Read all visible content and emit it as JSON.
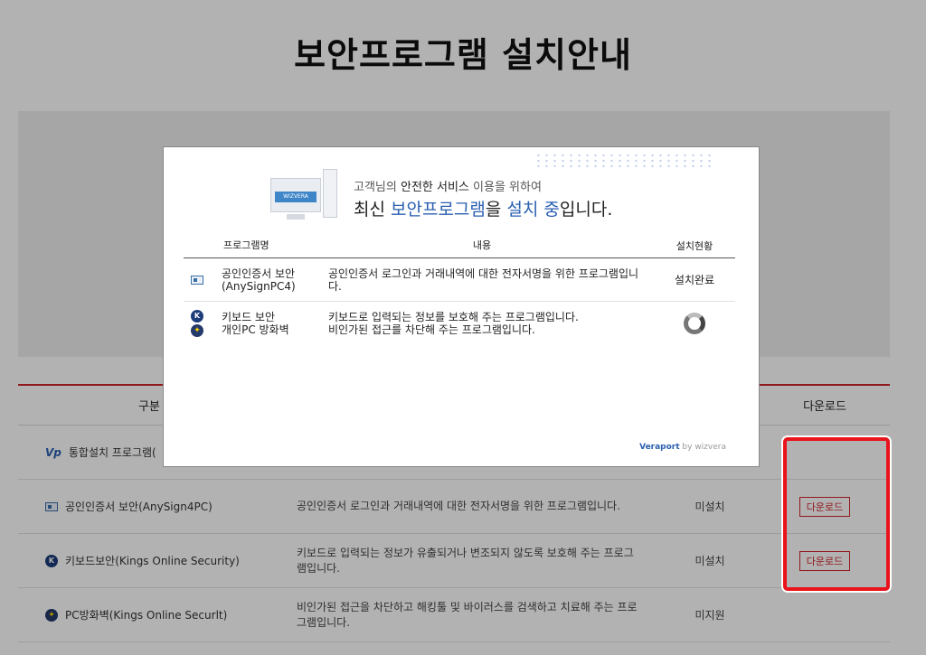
{
  "page": {
    "title": "보안프로그램 설치안내"
  },
  "table": {
    "headers": {
      "category": "구분",
      "download": "다운로드"
    },
    "rows": [
      {
        "icon": "vp-icon",
        "name": "통합설치 프로그램(",
        "desc": "",
        "status": "",
        "download": ""
      },
      {
        "icon": "certificate-icon",
        "name": "공인인증서 보안(AnySign4PC)",
        "desc": "공인인증서 로그인과 거래내역에 대한 전자서명을 위한 프로그램입니다.",
        "status": "미설치",
        "download": "다운로드"
      },
      {
        "icon": "kings-shield-icon",
        "name": "키보드보안(Kings Online Security)",
        "desc": "키보드로 입력되는 정보가 유출되거나 변조되지 않도록 보호해 주는 프로그램입니다.",
        "status": "미설치",
        "download": "다운로드"
      },
      {
        "icon": "firewall-icon",
        "name": "PC방화벽(Kings Online Securlt)",
        "desc": "비인가된 접근을 차단하고 해킹툴 및 바이러스를 검색하고 치료해 주는 프로그램입니다.",
        "status": "미지원",
        "download": ""
      }
    ]
  },
  "modal": {
    "monitor_label": "WIZVERA",
    "subtitle_pre": "고객님의 ",
    "subtitle_bold": "안전한 서비스",
    "subtitle_post": " 이용을 위하여",
    "heading_pre": "최신 ",
    "heading_blue1": "보안프로그램",
    "heading_mid": "을 ",
    "heading_blue2": "설치 중",
    "heading_post": "입니다.",
    "headers": {
      "program": "프로그램명",
      "content": "내용",
      "status": "설치현황"
    },
    "rows": [
      {
        "name_l1": "공인인증서 보안",
        "name_l2": "(AnySignPC4)",
        "desc_l1": "공인인증서 로그인과 거래내역에 대한 전자서명을 위한 프로그램입니",
        "desc_l2": "다.",
        "status": "설치완료"
      },
      {
        "name_l1": "키보드 보안",
        "name_l2": "개인PC 방화벽",
        "desc_l1": "키보드로 입력되는 정보를 보호해 주는 프로그램입니다.",
        "desc_l2": "비인가된 접근를 차단해 주는 프로그램입니다.",
        "status": ""
      }
    ],
    "footer_brand": "Veraport",
    "footer_by": " by wizvera"
  }
}
